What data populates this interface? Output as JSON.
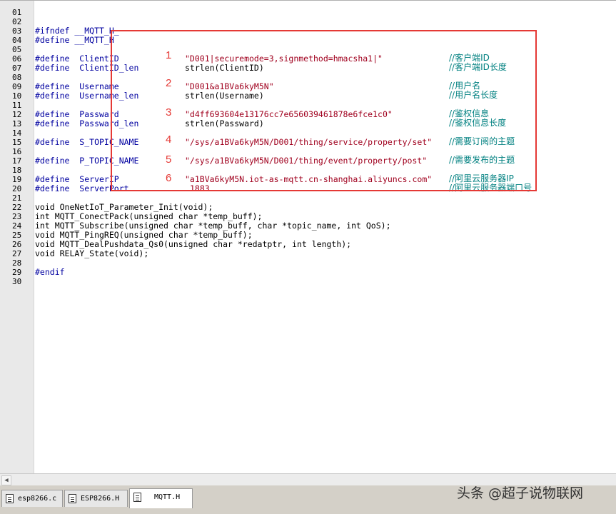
{
  "editor": {
    "line_numbers": [
      "01",
      "02",
      "03",
      "04",
      "05",
      "06",
      "07",
      "08",
      "09",
      "10",
      "11",
      "12",
      "13",
      "14",
      "15",
      "16",
      "17",
      "18",
      "19",
      "20",
      "21",
      "22",
      "23",
      "24",
      "25",
      "26",
      "27",
      "28",
      "29",
      "30"
    ],
    "lines": [
      [],
      [],
      [
        {
          "t": "#ifndef __MQTT_H_",
          "c": "kw"
        }
      ],
      [
        {
          "t": "#define __MQTT_H",
          "c": "kw"
        }
      ],
      [],
      [
        {
          "t": "#define  ClientID",
          "c": "kw"
        },
        {
          "t": "\"D001|securemode=3,signmethod=hmacsha1|\"",
          "c": "str"
        },
        {
          "t": "//客户端ID",
          "c": "cmt"
        }
      ],
      [
        {
          "t": "#define  ClientID_len",
          "c": "kw"
        },
        {
          "t": "strlen(ClientID)",
          "c": "plain"
        },
        {
          "t": "//客户端ID长度",
          "c": "cmt"
        }
      ],
      [],
      [
        {
          "t": "#define  Username",
          "c": "kw"
        },
        {
          "t": "\"D001&a1BVa6kyM5N\"",
          "c": "str"
        },
        {
          "t": "//用户名",
          "c": "cmt"
        }
      ],
      [
        {
          "t": "#define  Username_len",
          "c": "kw"
        },
        {
          "t": "strlen(Username)",
          "c": "plain"
        },
        {
          "t": "//用户名长度",
          "c": "cmt"
        }
      ],
      [],
      [
        {
          "t": "#define  Passward",
          "c": "kw"
        },
        {
          "t": "\"d4ff693604e13176cc7e656039461878e6fce1c0\"",
          "c": "str"
        },
        {
          "t": "//鉴权信息",
          "c": "cmt"
        }
      ],
      [
        {
          "t": "#define  Passward_len",
          "c": "kw"
        },
        {
          "t": "strlen(Passward)",
          "c": "plain"
        },
        {
          "t": "//鉴权信息长度",
          "c": "cmt"
        }
      ],
      [],
      [
        {
          "t": "#define  S_TOPIC_NAME",
          "c": "kw"
        },
        {
          "t": "\"/sys/a1BVa6kyM5N/D001/thing/service/property/set\"",
          "c": "str"
        },
        {
          "t": "//需要订阅的主题",
          "c": "cmt"
        }
      ],
      [],
      [
        {
          "t": "#define  P_TOPIC_NAME",
          "c": "kw"
        },
        {
          "t": "\"/sys/a1BVa6kyM5N/D001/thing/event/property/post\"",
          "c": "str"
        },
        {
          "t": "//需要发布的主题",
          "c": "cmt"
        }
      ],
      [],
      [
        {
          "t": "#define  ServerIP",
          "c": "kw"
        },
        {
          "t": "\"a1BVa6kyM5N.iot-as-mqtt.cn-shanghai.aliyuncs.com\"",
          "c": "str"
        },
        {
          "t": "//阿里云服务器IP",
          "c": "cmt"
        }
      ],
      [
        {
          "t": "#define  ServerPort",
          "c": "kw"
        },
        {
          "t": "1883",
          "c": "str"
        },
        {
          "t": "//阿里云服务器端口号",
          "c": "cmt"
        }
      ],
      [],
      [
        {
          "t": "void OneNetIoT_Parameter_Init(void);",
          "c": "plain"
        }
      ],
      [
        {
          "t": "int MQTT_ConectPack(unsigned char *temp_buff);",
          "c": "plain"
        }
      ],
      [
        {
          "t": "int MQTT_Subscribe(unsigned char *temp_buff, char *topic_name, int QoS);",
          "c": "plain"
        }
      ],
      [
        {
          "t": "void MQTT_PingREQ(unsigned char *temp_buff);",
          "c": "plain"
        }
      ],
      [
        {
          "t": "void MQTT_DealPushdata_Qs0(unsigned char *redatptr, int length);",
          "c": "plain"
        }
      ],
      [
        {
          "t": "void RELAY_State(void);",
          "c": "plain"
        }
      ],
      [],
      [
        {
          "t": "#endif",
          "c": "kw"
        }
      ],
      []
    ]
  },
  "annotations": [
    "1",
    "2",
    "3",
    "4",
    "5",
    "6"
  ],
  "tabs": [
    {
      "label": "esp8266.c",
      "active": false
    },
    {
      "label": "ESP8266.H",
      "active": false
    },
    {
      "label": "MQTT.H",
      "active": true
    }
  ],
  "watermark": "头条 @超子说物联网",
  "colors": {
    "annotation": "#e53935",
    "keyword": "#0000a0",
    "string": "#a0001e",
    "comment": "#008080"
  }
}
